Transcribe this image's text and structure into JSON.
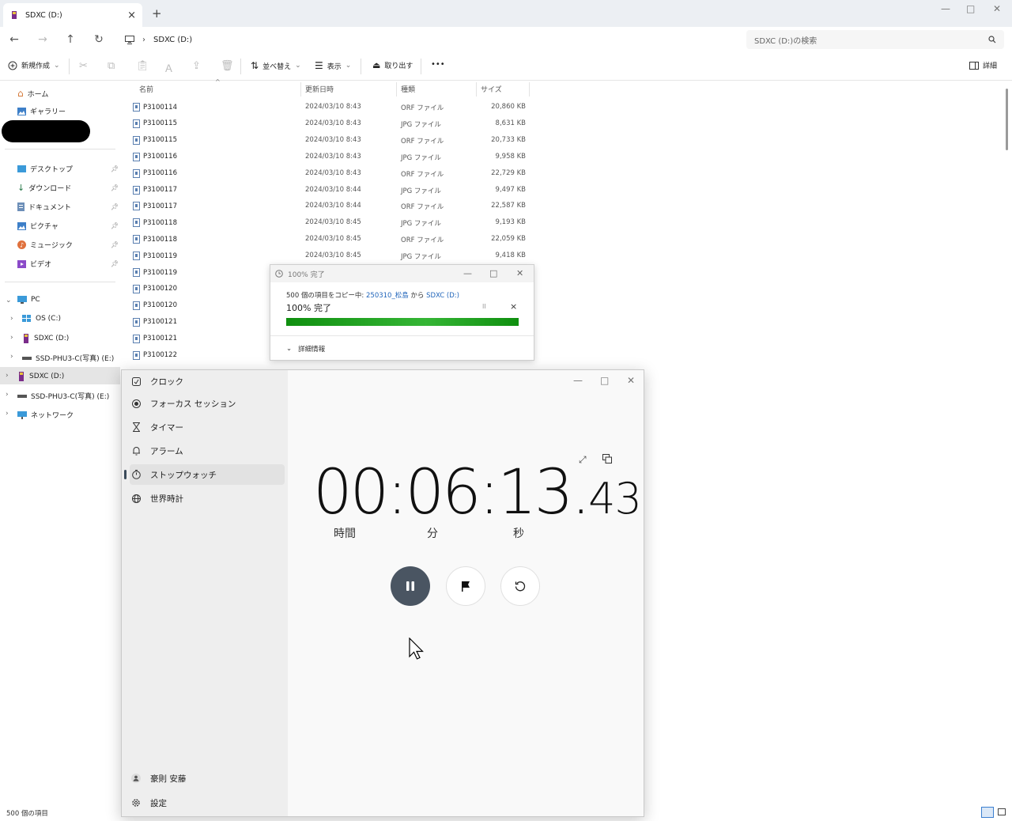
{
  "explorer": {
    "tab_title": "SDXC (D:)",
    "tab_close": "×",
    "new_tab": "+",
    "window_controls": {
      "minimize": "—",
      "maximize": "□",
      "close": "✕"
    },
    "address": {
      "path": "SDXC (D:)"
    },
    "search_placeholder": "SDXC (D:)の検索",
    "commands": {
      "new": "新規作成",
      "sort": "並べ替え",
      "view": "表示",
      "eject": "取り出す",
      "more": "•••",
      "details": "詳細"
    },
    "sidebar": {
      "home": "ホーム",
      "gallery": "ギャラリー",
      "quick": [
        "デスクトップ",
        "ダウンロード",
        "ドキュメント",
        "ピクチャ",
        "ミュージック",
        "ビデオ"
      ],
      "pc": "PC",
      "drives": [
        "OS (C:)",
        "SDXC (D:)",
        "SSD-PHU3-C(写真) (E:)"
      ],
      "root_items": [
        "SDXC (D:)",
        "SSD-PHU3-C(写真) (E:)",
        "ネットワーク"
      ]
    },
    "columns": {
      "name": "名前",
      "date": "更新日時",
      "type": "種類",
      "size": "サイズ"
    },
    "files": [
      {
        "name": "P3100114",
        "date": "2024/03/10 8:43",
        "type": "ORF ファイル",
        "size": "20,860 KB"
      },
      {
        "name": "P3100115",
        "date": "2024/03/10 8:43",
        "type": "JPG ファイル",
        "size": "8,631 KB"
      },
      {
        "name": "P3100115",
        "date": "2024/03/10 8:43",
        "type": "ORF ファイル",
        "size": "20,733 KB"
      },
      {
        "name": "P3100116",
        "date": "2024/03/10 8:43",
        "type": "JPG ファイル",
        "size": "9,958 KB"
      },
      {
        "name": "P3100116",
        "date": "2024/03/10 8:43",
        "type": "ORF ファイル",
        "size": "22,729 KB"
      },
      {
        "name": "P3100117",
        "date": "2024/03/10 8:44",
        "type": "JPG ファイル",
        "size": "9,497 KB"
      },
      {
        "name": "P3100117",
        "date": "2024/03/10 8:44",
        "type": "ORF ファイル",
        "size": "22,587 KB"
      },
      {
        "name": "P3100118",
        "date": "2024/03/10 8:45",
        "type": "JPG ファイル",
        "size": "9,193 KB"
      },
      {
        "name": "P3100118",
        "date": "2024/03/10 8:45",
        "type": "ORF ファイル",
        "size": "22,059 KB"
      },
      {
        "name": "P3100119",
        "date": "2024/03/10 8:45",
        "type": "JPG ファイル",
        "size": "9,418 KB"
      },
      {
        "name": "P3100119",
        "date": "",
        "type": "",
        "size": ""
      },
      {
        "name": "P3100120",
        "date": "",
        "type": "",
        "size": ""
      },
      {
        "name": "P3100120",
        "date": "",
        "type": "",
        "size": ""
      },
      {
        "name": "P3100121",
        "date": "",
        "type": "",
        "size": ""
      },
      {
        "name": "P3100121",
        "date": "",
        "type": "",
        "size": ""
      },
      {
        "name": "P3100122",
        "date": "",
        "type": "",
        "size": ""
      }
    ],
    "status": "500 個の項目"
  },
  "copy_dialog": {
    "title": "100% 完了",
    "description_prefix": "500 個の項目をコピー中: ",
    "source": "250310_松島",
    "from_word": " から ",
    "destination": "SDXC (D:)",
    "percent_text": "100% 完了",
    "progress": 1.0,
    "details": "詳細情報",
    "pause_glyph": "II",
    "cancel_glyph": "×"
  },
  "clock_app": {
    "nav": [
      "クロック",
      "フォーカス セッション",
      "タイマー",
      "アラーム",
      "ストップウォッチ",
      "世界時計"
    ],
    "active_nav": "ストップウォッチ",
    "user": "豪則 安藤",
    "settings": "設定",
    "time": {
      "main": "00:06:13.",
      "fraction": "43"
    },
    "labels": {
      "hours": "時間",
      "minutes": "分",
      "seconds": "秒"
    },
    "colors": {
      "pause_button": "#4a5562",
      "progress": "#16a016"
    }
  }
}
